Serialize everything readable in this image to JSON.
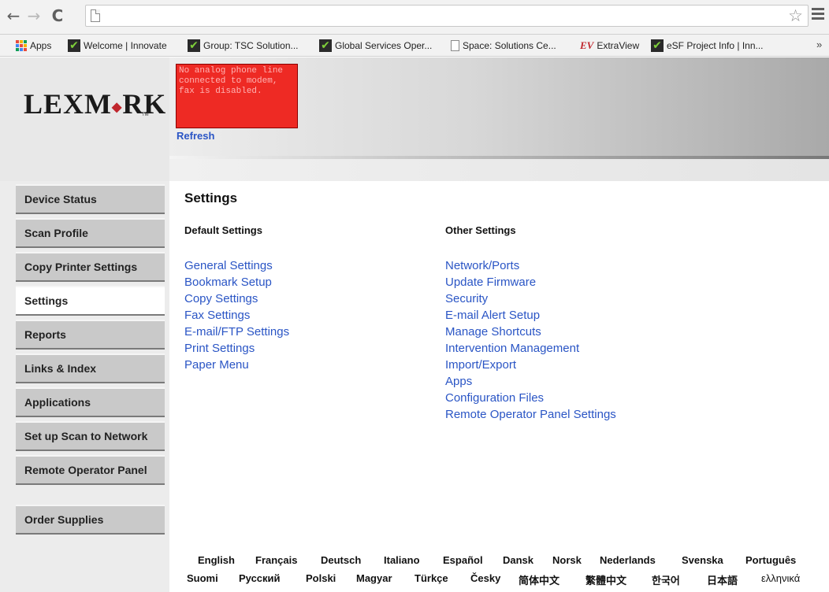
{
  "browser": {
    "back": "←",
    "forward": "→",
    "reload": "C",
    "bookmarks": [
      {
        "label": "Apps",
        "icon": "apps-grid-icon"
      },
      {
        "label": "Welcome | Innovate",
        "icon": "versionone-icon"
      },
      {
        "label": "Group: TSC Solution...",
        "icon": "versionone-icon"
      },
      {
        "label": "Global Services Oper...",
        "icon": "versionone-icon"
      },
      {
        "label": "Space: Solutions Ce...",
        "icon": "page-icon"
      },
      {
        "label": "ExtraView",
        "icon": "extraview-icon"
      },
      {
        "label": "eSF Project Info | Inn...",
        "icon": "versionone-icon"
      }
    ],
    "more": "»"
  },
  "header": {
    "logo": "LEXMARK",
    "logo_mark": "◆",
    "tm": "TM",
    "alert_text": "No analog phone line connected to modem, fax is disabled.",
    "refresh": "Refresh"
  },
  "sidebar": {
    "items": [
      {
        "label": "Device Status"
      },
      {
        "label": "Scan Profile"
      },
      {
        "label": "Copy Printer Settings"
      },
      {
        "label": "Settings"
      },
      {
        "label": "Reports"
      },
      {
        "label": "Links & Index"
      },
      {
        "label": "Applications"
      },
      {
        "label": "Set up Scan to Network"
      },
      {
        "label": "Remote Operator Panel"
      },
      {
        "label": "Order Supplies"
      }
    ]
  },
  "main": {
    "title": "Settings",
    "default_heading": "Default Settings",
    "other_heading": "Other Settings",
    "default_links": [
      "General Settings",
      "Bookmark Setup",
      "Copy Settings",
      "Fax Settings",
      "E-mail/FTP Settings",
      "Print Settings",
      "Paper Menu"
    ],
    "other_links": [
      "Network/Ports",
      "Update Firmware",
      "Security",
      "E-mail Alert Setup",
      "Manage Shortcuts",
      "Intervention Management",
      "Import/Export",
      "Apps",
      "Configuration Files",
      "Remote Operator Panel Settings"
    ]
  },
  "languages": {
    "row1": [
      "English",
      "Français",
      "Deutsch",
      "Italiano",
      "Español",
      "Dansk",
      "Norsk",
      "Nederlands",
      "Svenska",
      "Português"
    ],
    "row2": [
      "Suomi",
      "Русский",
      "Polski",
      "Magyar",
      "Türkçe",
      "Česky",
      "简体中文",
      "繁體中文",
      "한국어",
      "日本語",
      "ελληνικά"
    ]
  },
  "colors": {
    "link": "#2a55c5",
    "alert_bg": "#ee2a24",
    "logo_accent": "#c0262d"
  }
}
